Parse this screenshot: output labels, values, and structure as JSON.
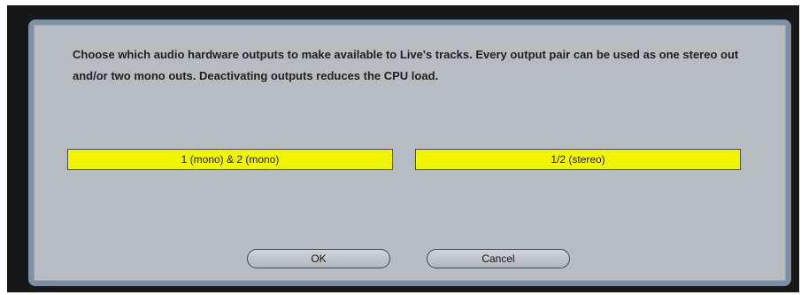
{
  "dialog": {
    "message": "Choose which audio hardware outputs to make available to Live's tracks. Every output pair can be used as one stereo out and/or two mono outs.  Deactivating outputs reduces the CPU load."
  },
  "outputs": [
    {
      "label": "1 (mono) & 2 (mono)",
      "active": true,
      "color": "#f2f500"
    },
    {
      "label": "1/2 (stereo)",
      "active": true,
      "color": "#f2f500"
    }
  ],
  "buttons": {
    "ok_label": "OK",
    "cancel_label": "Cancel"
  }
}
